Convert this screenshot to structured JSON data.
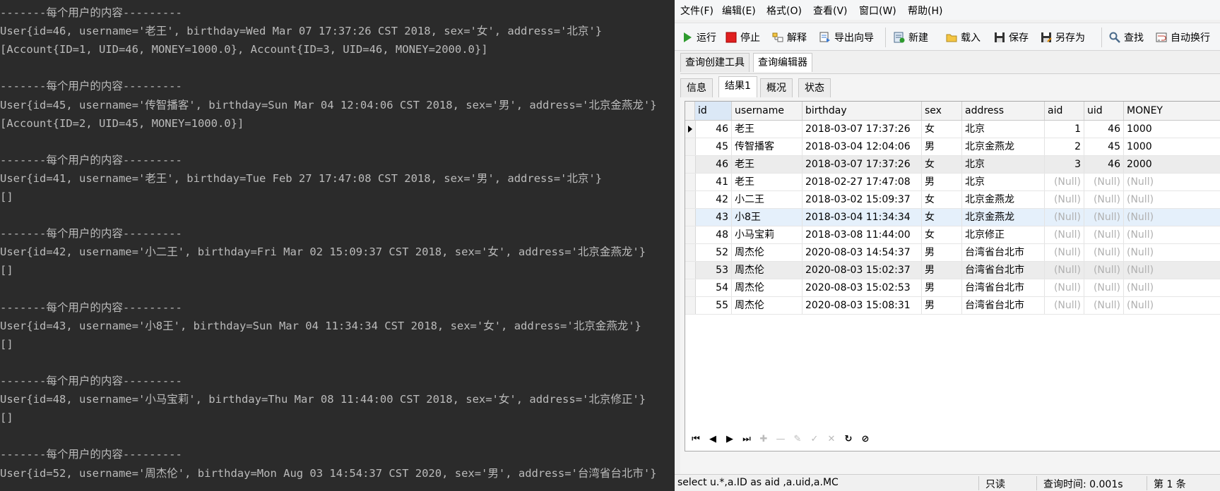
{
  "console": {
    "lines": [
      "-------每个用户的内容---------",
      "User{id=46, username='老王', birthday=Wed Mar 07 17:37:26 CST 2018, sex='女', address='北京'}",
      "[Account{ID=1, UID=46, MONEY=1000.0}, Account{ID=3, UID=46, MONEY=2000.0}]",
      "",
      "-------每个用户的内容---------",
      "User{id=45, username='传智播客', birthday=Sun Mar 04 12:04:06 CST 2018, sex='男', address='北京金燕龙'}",
      "[Account{ID=2, UID=45, MONEY=1000.0}]",
      "",
      "-------每个用户的内容---------",
      "User{id=41, username='老王', birthday=Tue Feb 27 17:47:08 CST 2018, sex='男', address='北京'}",
      "[]",
      "",
      "-------每个用户的内容---------",
      "User{id=42, username='小二王', birthday=Fri Mar 02 15:09:37 CST 2018, sex='女', address='北京金燕龙'}",
      "[]",
      "",
      "-------每个用户的内容---------",
      "User{id=43, username='小8王', birthday=Sun Mar 04 11:34:34 CST 2018, sex='女', address='北京金燕龙'}",
      "[]",
      "",
      "-------每个用户的内容---------",
      "User{id=48, username='小马宝莉', birthday=Thu Mar 08 11:44:00 CST 2018, sex='女', address='北京修正'}",
      "[]",
      "",
      "-------每个用户的内容---------",
      "User{id=52, username='周杰伦', birthday=Mon Aug 03 14:54:37 CST 2020, sex='男', address='台湾省台北市'}"
    ]
  },
  "menu": [
    "文件(F)",
    "编辑(E)",
    "格式(O)",
    "查看(V)",
    "窗口(W)",
    "帮助(H)"
  ],
  "toolbar": {
    "run": "运行",
    "stop": "停止",
    "explain": "解释",
    "export": "导出向导",
    "new": "新建",
    "load": "载入",
    "save": "保存",
    "save_as": "另存为",
    "find": "查找",
    "auto_wrap": "自动换行"
  },
  "tabs_top": [
    "查询创建工具",
    "查询编辑器"
  ],
  "tabs_result": [
    "信息",
    "结果1",
    "概况",
    "状态"
  ],
  "grid": {
    "columns": [
      "id",
      "username",
      "birthday",
      "sex",
      "address",
      "aid",
      "uid",
      "MONEY"
    ],
    "null_text": "(Null)",
    "rows": [
      {
        "id": "46",
        "username": "老王",
        "birthday": "2018-03-07 17:37:26",
        "sex": "女",
        "address": "北京",
        "aid": "1",
        "uid": "46",
        "money": "1000"
      },
      {
        "id": "45",
        "username": "传智播客",
        "birthday": "2018-03-04 12:04:06",
        "sex": "男",
        "address": "北京金燕龙",
        "aid": "2",
        "uid": "45",
        "money": "1000"
      },
      {
        "id": "46",
        "username": "老王",
        "birthday": "2018-03-07 17:37:26",
        "sex": "女",
        "address": "北京",
        "aid": "3",
        "uid": "46",
        "money": "2000"
      },
      {
        "id": "41",
        "username": "老王",
        "birthday": "2018-02-27 17:47:08",
        "sex": "男",
        "address": "北京",
        "aid": "(Null)",
        "uid": "(Null)",
        "money": "(Null)"
      },
      {
        "id": "42",
        "username": "小二王",
        "birthday": "2018-03-02 15:09:37",
        "sex": "女",
        "address": "北京金燕龙",
        "aid": "(Null)",
        "uid": "(Null)",
        "money": "(Null)"
      },
      {
        "id": "43",
        "username": "小8王",
        "birthday": "2018-03-04 11:34:34",
        "sex": "女",
        "address": "北京金燕龙",
        "aid": "(Null)",
        "uid": "(Null)",
        "money": "(Null)"
      },
      {
        "id": "48",
        "username": "小马宝莉",
        "birthday": "2018-03-08 11:44:00",
        "sex": "女",
        "address": "北京修正",
        "aid": "(Null)",
        "uid": "(Null)",
        "money": "(Null)"
      },
      {
        "id": "52",
        "username": "周杰伦",
        "birthday": "2020-08-03 14:54:37",
        "sex": "男",
        "address": "台湾省台北市",
        "aid": "(Null)",
        "uid": "(Null)",
        "money": "(Null)"
      },
      {
        "id": "53",
        "username": "周杰伦",
        "birthday": "2020-08-03 15:02:37",
        "sex": "男",
        "address": "台湾省台北市",
        "aid": "(Null)",
        "uid": "(Null)",
        "money": "(Null)"
      },
      {
        "id": "54",
        "username": "周杰伦",
        "birthday": "2020-08-03 15:02:53",
        "sex": "男",
        "address": "台湾省台北市",
        "aid": "(Null)",
        "uid": "(Null)",
        "money": "(Null)"
      },
      {
        "id": "55",
        "username": "周杰伦",
        "birthday": "2020-08-03 15:08:31",
        "sex": "男",
        "address": "台湾省台北市",
        "aid": "(Null)",
        "uid": "(Null)",
        "money": "(Null)"
      }
    ]
  },
  "status": {
    "sql": "select u.*,a.ID as aid ,a.uid,a.MC",
    "mode": "只读",
    "query_time": "查询时间: 0.001s",
    "record": "第 1 条"
  },
  "colors": {
    "console_bg": "#2b2b2b",
    "console_text": "#bbbbbb",
    "run_green": "#2e9b2e",
    "stop_red": "#e02020",
    "null_grey": "#b0b0b0",
    "selected_row": "#e5f0fb"
  }
}
